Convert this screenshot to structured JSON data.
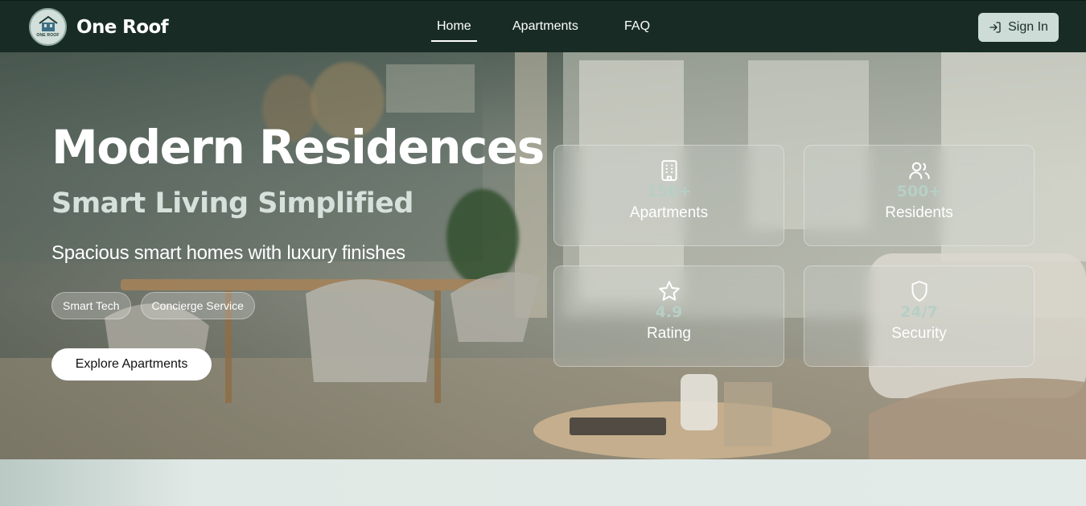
{
  "brand": {
    "logo_text": "ONE ROOF",
    "name": "One Roof"
  },
  "nav": {
    "items": [
      "Home",
      "Apartments",
      "FAQ"
    ],
    "active": "Home",
    "signin_label": "Sign In"
  },
  "hero": {
    "title": "Modern Residences",
    "subtitle": "Smart Living Simplified",
    "description": "Spacious smart homes with luxury finishes",
    "chips": [
      "Smart Tech",
      "Concierge Service"
    ],
    "cta_label": "Explore Apartments"
  },
  "stats": [
    {
      "icon": "building-icon",
      "value": "150+",
      "label": "Apartments"
    },
    {
      "icon": "users-icon",
      "value": "500+",
      "label": "Residents"
    },
    {
      "icon": "star-icon",
      "value": "4.9",
      "label": "Rating"
    },
    {
      "icon": "shield-icon",
      "value": "24/7",
      "label": "Security"
    }
  ],
  "colors": {
    "navbar": "#182c25",
    "accent_value": "#b7cfc6",
    "signin_bg": "#cddcd7"
  }
}
